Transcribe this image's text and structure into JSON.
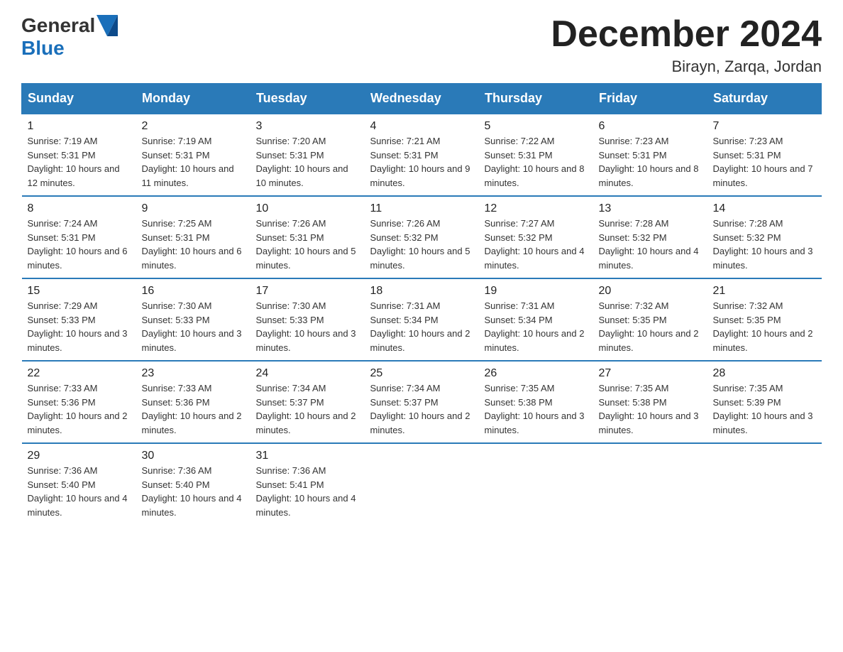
{
  "logo": {
    "general": "General",
    "blue": "Blue"
  },
  "title": "December 2024",
  "location": "Birayn, Zarqa, Jordan",
  "days_of_week": [
    "Sunday",
    "Monday",
    "Tuesday",
    "Wednesday",
    "Thursday",
    "Friday",
    "Saturday"
  ],
  "weeks": [
    [
      {
        "day": "1",
        "sunrise": "7:19 AM",
        "sunset": "5:31 PM",
        "daylight": "10 hours and 12 minutes."
      },
      {
        "day": "2",
        "sunrise": "7:19 AM",
        "sunset": "5:31 PM",
        "daylight": "10 hours and 11 minutes."
      },
      {
        "day": "3",
        "sunrise": "7:20 AM",
        "sunset": "5:31 PM",
        "daylight": "10 hours and 10 minutes."
      },
      {
        "day": "4",
        "sunrise": "7:21 AM",
        "sunset": "5:31 PM",
        "daylight": "10 hours and 9 minutes."
      },
      {
        "day": "5",
        "sunrise": "7:22 AM",
        "sunset": "5:31 PM",
        "daylight": "10 hours and 8 minutes."
      },
      {
        "day": "6",
        "sunrise": "7:23 AM",
        "sunset": "5:31 PM",
        "daylight": "10 hours and 8 minutes."
      },
      {
        "day": "7",
        "sunrise": "7:23 AM",
        "sunset": "5:31 PM",
        "daylight": "10 hours and 7 minutes."
      }
    ],
    [
      {
        "day": "8",
        "sunrise": "7:24 AM",
        "sunset": "5:31 PM",
        "daylight": "10 hours and 6 minutes."
      },
      {
        "day": "9",
        "sunrise": "7:25 AM",
        "sunset": "5:31 PM",
        "daylight": "10 hours and 6 minutes."
      },
      {
        "day": "10",
        "sunrise": "7:26 AM",
        "sunset": "5:31 PM",
        "daylight": "10 hours and 5 minutes."
      },
      {
        "day": "11",
        "sunrise": "7:26 AM",
        "sunset": "5:32 PM",
        "daylight": "10 hours and 5 minutes."
      },
      {
        "day": "12",
        "sunrise": "7:27 AM",
        "sunset": "5:32 PM",
        "daylight": "10 hours and 4 minutes."
      },
      {
        "day": "13",
        "sunrise": "7:28 AM",
        "sunset": "5:32 PM",
        "daylight": "10 hours and 4 minutes."
      },
      {
        "day": "14",
        "sunrise": "7:28 AM",
        "sunset": "5:32 PM",
        "daylight": "10 hours and 3 minutes."
      }
    ],
    [
      {
        "day": "15",
        "sunrise": "7:29 AM",
        "sunset": "5:33 PM",
        "daylight": "10 hours and 3 minutes."
      },
      {
        "day": "16",
        "sunrise": "7:30 AM",
        "sunset": "5:33 PM",
        "daylight": "10 hours and 3 minutes."
      },
      {
        "day": "17",
        "sunrise": "7:30 AM",
        "sunset": "5:33 PM",
        "daylight": "10 hours and 3 minutes."
      },
      {
        "day": "18",
        "sunrise": "7:31 AM",
        "sunset": "5:34 PM",
        "daylight": "10 hours and 2 minutes."
      },
      {
        "day": "19",
        "sunrise": "7:31 AM",
        "sunset": "5:34 PM",
        "daylight": "10 hours and 2 minutes."
      },
      {
        "day": "20",
        "sunrise": "7:32 AM",
        "sunset": "5:35 PM",
        "daylight": "10 hours and 2 minutes."
      },
      {
        "day": "21",
        "sunrise": "7:32 AM",
        "sunset": "5:35 PM",
        "daylight": "10 hours and 2 minutes."
      }
    ],
    [
      {
        "day": "22",
        "sunrise": "7:33 AM",
        "sunset": "5:36 PM",
        "daylight": "10 hours and 2 minutes."
      },
      {
        "day": "23",
        "sunrise": "7:33 AM",
        "sunset": "5:36 PM",
        "daylight": "10 hours and 2 minutes."
      },
      {
        "day": "24",
        "sunrise": "7:34 AM",
        "sunset": "5:37 PM",
        "daylight": "10 hours and 2 minutes."
      },
      {
        "day": "25",
        "sunrise": "7:34 AM",
        "sunset": "5:37 PM",
        "daylight": "10 hours and 2 minutes."
      },
      {
        "day": "26",
        "sunrise": "7:35 AM",
        "sunset": "5:38 PM",
        "daylight": "10 hours and 3 minutes."
      },
      {
        "day": "27",
        "sunrise": "7:35 AM",
        "sunset": "5:38 PM",
        "daylight": "10 hours and 3 minutes."
      },
      {
        "day": "28",
        "sunrise": "7:35 AM",
        "sunset": "5:39 PM",
        "daylight": "10 hours and 3 minutes."
      }
    ],
    [
      {
        "day": "29",
        "sunrise": "7:36 AM",
        "sunset": "5:40 PM",
        "daylight": "10 hours and 4 minutes."
      },
      {
        "day": "30",
        "sunrise": "7:36 AM",
        "sunset": "5:40 PM",
        "daylight": "10 hours and 4 minutes."
      },
      {
        "day": "31",
        "sunrise": "7:36 AM",
        "sunset": "5:41 PM",
        "daylight": "10 hours and 4 minutes."
      },
      null,
      null,
      null,
      null
    ]
  ]
}
